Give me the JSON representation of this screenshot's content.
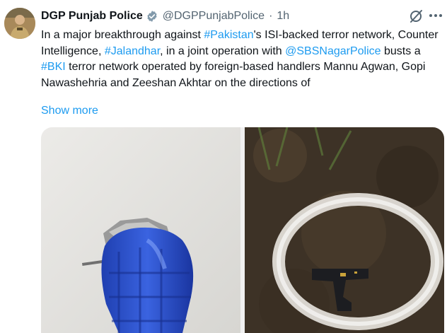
{
  "author": {
    "name": "DGP Punjab Police",
    "handle": "@DGPPunjabPolice",
    "separator": "·",
    "time": "1h",
    "verified_icon": "verified-badge-icon",
    "avatar_icon": "profile-avatar"
  },
  "tweet": {
    "seg1": "In a major breakthrough against ",
    "tag_pakistan": "#Pakistan",
    "seg2": "'s ISI-backed terror network, Counter Intelligence, ",
    "tag_jalandhar": "#Jalandhar",
    "seg3": ", in a joint operation with ",
    "mention_sbs": "@SBSNagarPolice",
    "seg4": " busts a ",
    "tag_bki": "#BKI",
    "seg5": " terror network operated by foreign-based handlers Mannu Agwan, Gopi Nawashehria and Zeeshan Akhtar on the directions of",
    "show_more": "Show more"
  },
  "actions": {
    "grok_icon": "grok-icon",
    "more_icon": "more-options-icon"
  },
  "media": [
    {
      "icon": "photo-grenade"
    },
    {
      "icon": "photo-pistol-in-chalk-circle"
    }
  ],
  "colors": {
    "link": "#1d9bf0",
    "secondary_text": "#536471",
    "primary_text": "#0f1419"
  }
}
